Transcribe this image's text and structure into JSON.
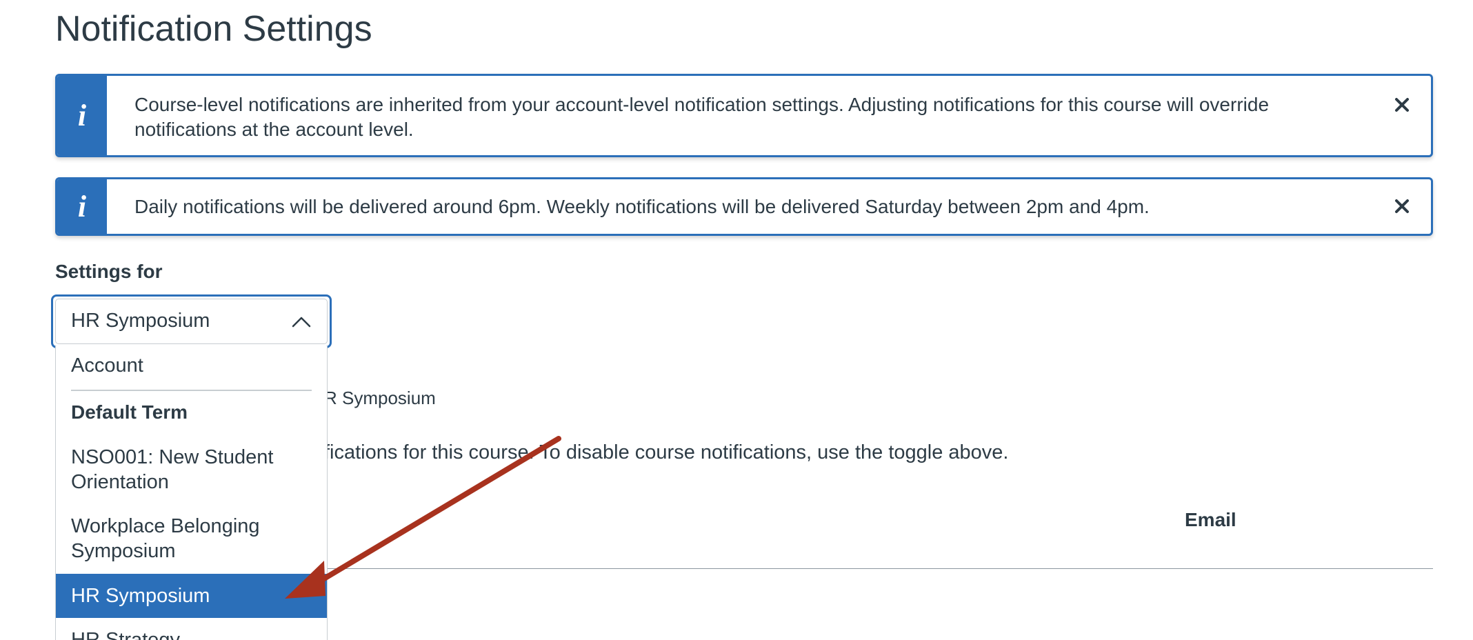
{
  "page": {
    "title": "Notification Settings"
  },
  "alerts": [
    {
      "icon": "info-icon",
      "icon_glyph": "i",
      "text": "Course-level notifications are inherited from your account-level notification settings. Adjusting notifications for this course will override notifications at the account level.",
      "close_glyph": "✕"
    },
    {
      "icon": "info-icon",
      "icon_glyph": "i",
      "text": "Daily notifications will be delivered around 6pm. Weekly notifications will be delivered Saturday between 2pm and 4pm.",
      "close_glyph": "✕"
    }
  ],
  "settings": {
    "label": "Settings for",
    "selected_value": "HR Symposium",
    "chevron_icon": "chevron-up-icon"
  },
  "dropdown": {
    "account_option": "Account",
    "group_label": "Default Term",
    "options": [
      "NSO001: New Student Orientation",
      "Workplace Belonging Symposium",
      "HR Symposium",
      "HR Strategy"
    ],
    "selected_index": 2
  },
  "background": {
    "course_name_fragment": "R Symposium",
    "course_notice_fragment": "fications for this course. To disable course notifications, use the toggle above.",
    "column_email": "Email"
  },
  "annotation": {
    "arrow_color": "#a8321e"
  },
  "colors": {
    "accent": "#2b6fb9",
    "text": "#2d3b45"
  }
}
